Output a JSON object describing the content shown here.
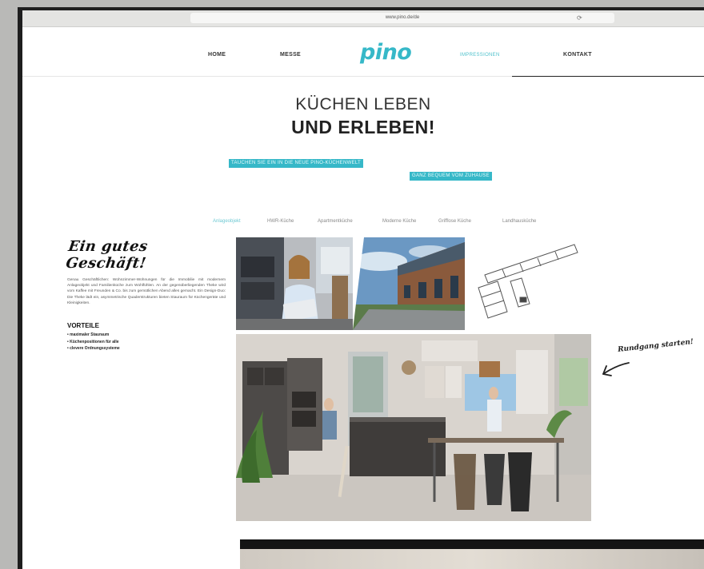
{
  "browser": {
    "url": "www.pino.de/de",
    "reload_icon": "reload-icon"
  },
  "nav": {
    "items": [
      "HOME",
      "MESSE",
      "IMPRESSIONEN",
      "KONTAKT"
    ],
    "active": "IMPRESSIONEN",
    "logo": "pino",
    "brand_color": "#36b8c8"
  },
  "hero": {
    "line1": "KÜCHEN LEBEN",
    "line2": "UND ERLEBEN!",
    "highlight1": "TAUCHEN SIE EIN IN DIE NEUE PINO-KÜCHENWELT",
    "highlight2": "GANZ BEQUEM VOM ZUHAUSE"
  },
  "tabs": {
    "items": [
      "Anlageobjekt",
      "HWR-Küche",
      "Apartmentküche",
      "Moderne Küche",
      "Grifflose Küche",
      "Landhausküche"
    ],
    "active": 0
  },
  "sidebar": {
    "title": "Ein gutes Geschäft!",
    "body": "Genau Geschäftlichen: Wohnzimmer-Wohnungen für die Immobilie mit modernem Anlageobjekt und Familienküche zum Wohlfühlen. An der gegenüberliegenden Theke wird vom Kaffee mit Freunden & Co. bis zum gemütlichen Abend alles gemacht. Ein Design-Duo: Die Theke lädt ein, asymmetrische Quaderstrukturen bieten Stauraum für Küchengeräte und Kleinigkeiten.",
    "advantages_title": "VORTEILE",
    "advantages": [
      "• maximaler Stauraum",
      "• Küchenpositionen für alle",
      "• clevere Ordnungssysteme"
    ]
  },
  "tour": {
    "label": "Rundgang starten!",
    "arrow_icon": "hand-drawn-arrow-icon"
  }
}
